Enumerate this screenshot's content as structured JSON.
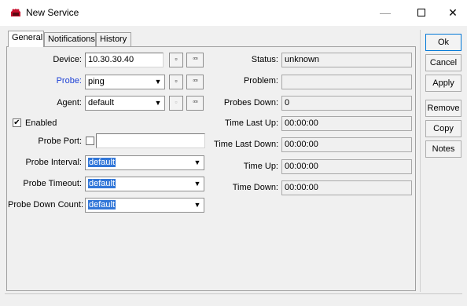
{
  "window": {
    "title": "New Service",
    "min_glyph": "—",
    "close_glyph": "✕"
  },
  "tabs": [
    {
      "label": "General",
      "active": true
    },
    {
      "label": "Notifications",
      "active": false
    },
    {
      "label": "History",
      "active": false
    }
  ],
  "form": {
    "device": {
      "label": "Device:",
      "value": "10.30.30.40"
    },
    "probe": {
      "label": "Probe:",
      "value": "ping"
    },
    "agent": {
      "label": "Agent:",
      "value": "default"
    },
    "enabled": {
      "label": "Enabled",
      "checked": true,
      "mark": "✔"
    },
    "probe_port": {
      "label": "Probe Port:",
      "value": ""
    },
    "probe_interval": {
      "label": "Probe Interval:",
      "value": "default"
    },
    "probe_timeout": {
      "label": "Probe Timeout:",
      "value": "default"
    },
    "probe_down_count": {
      "label": "Probe Down Count:",
      "value": "default"
    }
  },
  "small_buttons": {
    "single_glyph": "▫",
    "dots_glyph": "▫▫▫",
    "arrow_glyph": "▼"
  },
  "status": {
    "status": {
      "label": "Status:",
      "value": "unknown"
    },
    "problem": {
      "label": "Problem:",
      "value": ""
    },
    "probes_down": {
      "label": "Probes Down:",
      "value": "0"
    },
    "time_last_up": {
      "label": "Time Last Up:",
      "value": "00:00:00"
    },
    "time_last_down": {
      "label": "Time Last Down:",
      "value": "00:00:00"
    },
    "time_up": {
      "label": "Time Up:",
      "value": "00:00:00"
    },
    "time_down": {
      "label": "Time Down:",
      "value": "00:00:00"
    }
  },
  "buttons": {
    "ok": "Ok",
    "cancel": "Cancel",
    "apply": "Apply",
    "remove": "Remove",
    "copy": "Copy",
    "notes": "Notes"
  },
  "colors": {
    "accent": "#1b3fd6",
    "selection": "#3176d8",
    "default_button_border": "#0078d7"
  }
}
